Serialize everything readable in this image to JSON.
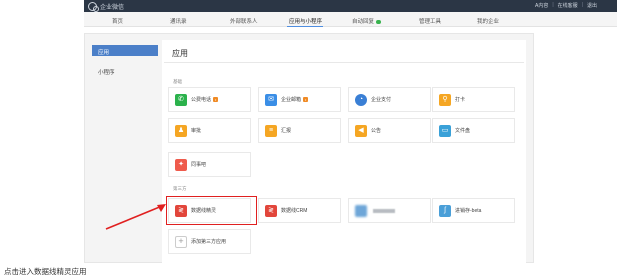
{
  "app": {
    "title": "企业微信"
  },
  "top_right": {
    "admin": "A内容",
    "help": "在线客服",
    "logout": "退出"
  },
  "nav": {
    "items": [
      {
        "label": "首页"
      },
      {
        "label": "通讯录"
      },
      {
        "label": "外部联系人"
      },
      {
        "label": "应用与小程序",
        "active": true
      },
      {
        "label": "自动回复"
      },
      {
        "label": "管理工具"
      },
      {
        "label": "我的企业"
      }
    ]
  },
  "sidebar": {
    "items": [
      {
        "label": "应用",
        "active": true
      },
      {
        "label": "小程序"
      }
    ]
  },
  "main": {
    "title": "应用",
    "groups": [
      {
        "label": "基础",
        "apps": [
          {
            "label": "公费电话",
            "icon": "phone-icon",
            "color": "#2bb24c",
            "badge": true
          },
          {
            "label": "企业邮箱",
            "icon": "mail-icon",
            "color": "#3a8ee6",
            "badge": true
          },
          {
            "label": "企业支付",
            "icon": "pay-icon",
            "color": "#3a7fd5"
          },
          {
            "label": "打卡",
            "icon": "location-icon",
            "color": "#f5a623"
          },
          {
            "label": "审批",
            "icon": "approval-icon",
            "color": "#f5a623"
          },
          {
            "label": "汇报",
            "icon": "report-icon",
            "color": "#f5a623"
          },
          {
            "label": "公告",
            "icon": "announce-icon",
            "color": "#f5a623"
          },
          {
            "label": "文件盘",
            "icon": "disk-icon",
            "color": "#3aa1d8"
          },
          {
            "label": "同事吧",
            "icon": "colleague-icon",
            "color": "#ef5b4c"
          }
        ]
      },
      {
        "label": "第三方",
        "apps": [
          {
            "label": "数据线精灵",
            "icon": "datalink-icon",
            "color": "#e2463b",
            "highlighted": true
          },
          {
            "label": "数据线CRM",
            "icon": "crm-icon",
            "color": "#e2463b"
          },
          {
            "label": "",
            "icon": "blurred-app-icon",
            "color": "#6ea6d8",
            "blurred": true
          },
          {
            "label": "进销存-beta",
            "icon": "inventory-icon",
            "color": "#4a9fd8"
          },
          {
            "label": "添加第三方应用",
            "icon": "add-icon",
            "color": "#ffffff",
            "add": true
          }
        ]
      }
    ]
  },
  "caption": "点击进入数据线精灵应用"
}
